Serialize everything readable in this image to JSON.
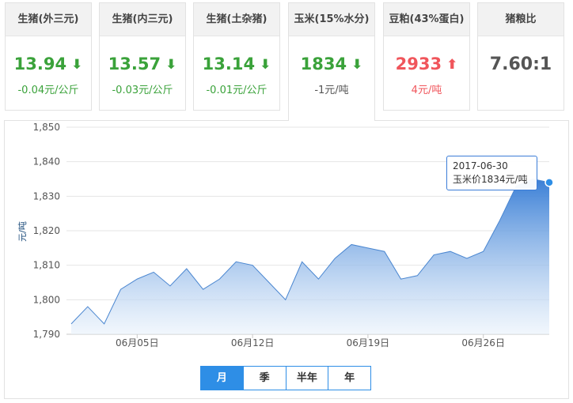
{
  "cards": [
    {
      "title": "生猪(外三元)",
      "price": "13.94",
      "trend": "down",
      "change": "-0.04元/公斤"
    },
    {
      "title": "生猪(内三元)",
      "price": "13.57",
      "trend": "down",
      "change": "-0.03元/公斤"
    },
    {
      "title": "生猪(土杂猪)",
      "price": "13.14",
      "trend": "down",
      "change": "-0.01元/公斤"
    },
    {
      "title": "玉米(15%水分)",
      "price": "1834",
      "trend": "down",
      "change": "-1元/吨"
    },
    {
      "title": "豆粕(43%蛋白)",
      "price": "2933",
      "trend": "up",
      "change": "4元/吨"
    }
  ],
  "ratio": {
    "title": "猪粮比",
    "value": "7.60:1"
  },
  "colors": {
    "down": "#3aa23a",
    "up": "#f0555b",
    "area_top": "#3a7fd6",
    "area_bottom": "#e8f1fb",
    "line": "#4a86d0",
    "accent": "#2e8ee6"
  },
  "chart_data": {
    "type": "area",
    "title": "",
    "ylabel": "元/吨",
    "xlabel": "",
    "ylim": [
      1790,
      1850
    ],
    "yticks": [
      1790,
      1800,
      1810,
      1820,
      1830,
      1840,
      1850
    ],
    "ytick_labels": [
      "1,790",
      "1,800",
      "1,810",
      "1,820",
      "1,830",
      "1,840",
      "1,850"
    ],
    "x_dates": [
      "2017-06-01",
      "2017-06-02",
      "2017-06-03",
      "2017-06-04",
      "2017-06-05",
      "2017-06-06",
      "2017-06-07",
      "2017-06-08",
      "2017-06-09",
      "2017-06-10",
      "2017-06-11",
      "2017-06-12",
      "2017-06-13",
      "2017-06-14",
      "2017-06-15",
      "2017-06-16",
      "2017-06-17",
      "2017-06-18",
      "2017-06-19",
      "2017-06-20",
      "2017-06-21",
      "2017-06-22",
      "2017-06-23",
      "2017-06-24",
      "2017-06-25",
      "2017-06-26",
      "2017-06-27",
      "2017-06-28",
      "2017-06-29",
      "2017-06-30"
    ],
    "series": [
      {
        "values": [
          1793,
          1798,
          1793,
          1803,
          1806,
          1808,
          1804,
          1809,
          1803,
          1806,
          1811,
          1810,
          1805,
          1800,
          1811,
          1806,
          1812,
          1816,
          1815,
          1814,
          1806,
          1807,
          1813,
          1814,
          1812,
          1814,
          1823,
          1833,
          1835,
          1834
        ]
      }
    ],
    "xticks": [
      {
        "date": "2017-06-05",
        "label": "06月05日"
      },
      {
        "date": "2017-06-12",
        "label": "06月12日"
      },
      {
        "date": "2017-06-19",
        "label": "06月19日"
      },
      {
        "date": "2017-06-26",
        "label": "06月26日"
      }
    ],
    "grid": true,
    "highlight": {
      "date": "2017-06-30",
      "value": 1834
    }
  },
  "tooltip": {
    "date": "2017-06-30",
    "text": "玉米价1834元/吨"
  },
  "range_tabs": [
    "月",
    "季",
    "半年",
    "年"
  ],
  "range_selected": "月"
}
